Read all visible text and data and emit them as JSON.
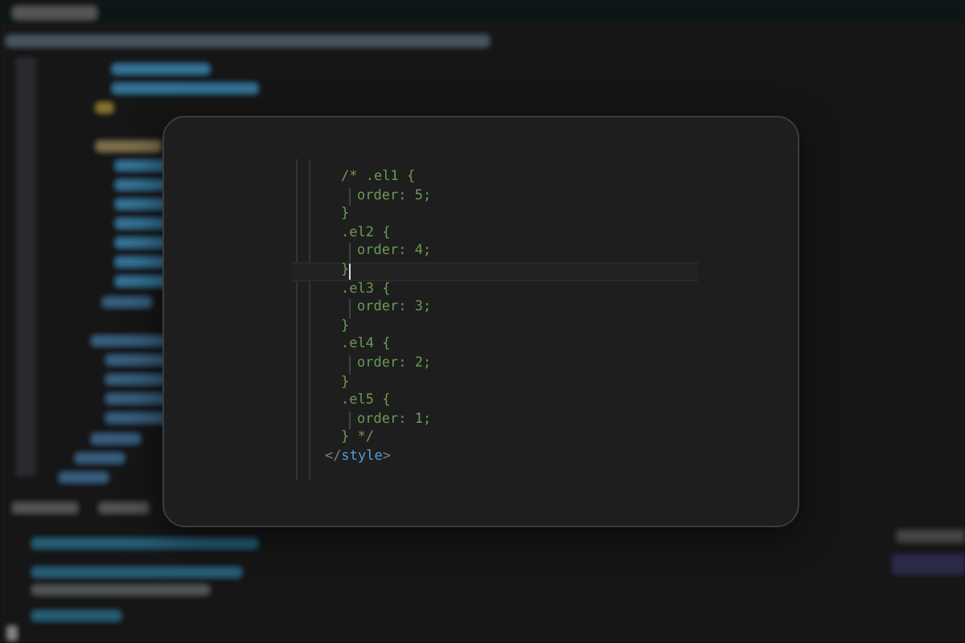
{
  "code_card": {
    "lines": [
      {
        "indented": false,
        "active": false,
        "tokens": [
          {
            "text": "/* .el1 {",
            "kind": "comment"
          }
        ]
      },
      {
        "indented": true,
        "active": false,
        "tokens": [
          {
            "text": "order: 5;",
            "kind": "comment"
          }
        ]
      },
      {
        "indented": false,
        "active": false,
        "tokens": [
          {
            "text": "}",
            "kind": "comment"
          }
        ]
      },
      {
        "indented": false,
        "active": false,
        "tokens": [
          {
            "text": ".el2 {",
            "kind": "comment"
          }
        ]
      },
      {
        "indented": true,
        "active": false,
        "tokens": [
          {
            "text": "order: 4;",
            "kind": "comment"
          }
        ]
      },
      {
        "indented": false,
        "active": true,
        "tokens": [
          {
            "text": "}",
            "kind": "comment"
          }
        ]
      },
      {
        "indented": false,
        "active": false,
        "tokens": [
          {
            "text": ".el3 {",
            "kind": "comment"
          }
        ]
      },
      {
        "indented": true,
        "active": false,
        "tokens": [
          {
            "text": "order: 3;",
            "kind": "comment"
          }
        ]
      },
      {
        "indented": false,
        "active": false,
        "tokens": [
          {
            "text": "}",
            "kind": "comment"
          }
        ]
      },
      {
        "indented": false,
        "active": false,
        "tokens": [
          {
            "text": ".el4 {",
            "kind": "comment"
          }
        ]
      },
      {
        "indented": true,
        "active": false,
        "tokens": [
          {
            "text": "order: 2;",
            "kind": "comment"
          }
        ]
      },
      {
        "indented": false,
        "active": false,
        "tokens": [
          {
            "text": "}",
            "kind": "comment"
          }
        ]
      },
      {
        "indented": false,
        "active": false,
        "tokens": [
          {
            "text": ".el5 {",
            "kind": "comment"
          }
        ]
      },
      {
        "indented": true,
        "active": false,
        "tokens": [
          {
            "text": "order: 1;",
            "kind": "comment"
          }
        ]
      },
      {
        "indented": false,
        "active": false,
        "tokens": [
          {
            "text": "} */",
            "kind": "comment"
          }
        ]
      }
    ],
    "closing_tag": [
      {
        "text": "</",
        "kind": "punct"
      },
      {
        "text": "style",
        "kind": "tag"
      },
      {
        "text": ">",
        "kind": "punct"
      }
    ]
  }
}
